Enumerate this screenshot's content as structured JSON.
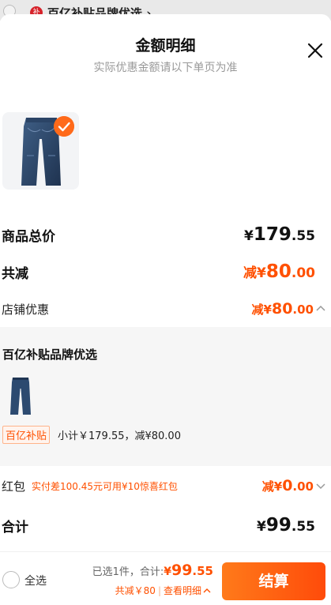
{
  "background": {
    "shop_badge": "补",
    "shop_name": "百亿补贴品牌优选 ›"
  },
  "header": {
    "title": "金额明细",
    "subtitle": "实际优惠金额请以下单页为准"
  },
  "product": {
    "image_icon": "jeans-icon",
    "selected_icon": "checkmark-icon"
  },
  "summary": {
    "goods_total_label": "商品总价",
    "goods_total_symbol": "¥",
    "goods_total_int": "179",
    "goods_total_dec": ".55",
    "total_discount_label": "共减",
    "total_discount_prefix": "减¥",
    "total_discount_int": "80",
    "total_discount_dec": ".00",
    "store_discount_label": "店铺优惠",
    "store_discount_prefix": "减¥",
    "store_discount_int": "80",
    "store_discount_dec": ".00",
    "store_discount_chevron": "chevron-up-icon"
  },
  "store_panel": {
    "title": "百亿补贴品牌优选",
    "tag": "百亿补贴",
    "subtotal_text": "小计￥179.55，减¥80.00"
  },
  "red_packet": {
    "label": "红包",
    "note": "实付差100.45元可用¥10惊喜红包",
    "prefix": "减¥",
    "int": "0",
    "dec": ".00",
    "chevron": "chevron-down-icon"
  },
  "total": {
    "label": "合计",
    "symbol": "¥",
    "int": "99",
    "dec": ".55"
  },
  "bottom_bar": {
    "select_all": "全选",
    "selected_text": "已选1件，合计:",
    "amount_symbol": "¥",
    "amount_int": "99",
    "amount_dec": ".55",
    "discount_text": "共减￥80",
    "detail_text": "查看明细",
    "checkout": "结算"
  },
  "colors": {
    "accent": "#ff5000",
    "button_start": "#ff7a1a",
    "button_end": "#ff4b0a"
  }
}
